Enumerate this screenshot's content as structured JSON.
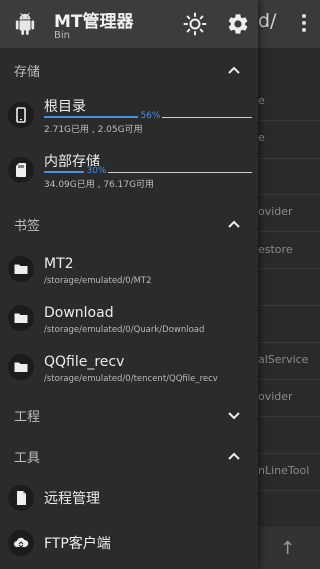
{
  "header": {
    "title": "MT管理器",
    "subtitle": "Bin",
    "icons": {
      "logo": "android-icon",
      "theme": "brightness-icon",
      "settings": "gear-icon"
    }
  },
  "background": {
    "path_fragment": "d/",
    "list_fragments": [
      "e",
      "e",
      "ovider",
      "estore",
      "alService",
      "ovider",
      "nLineTool"
    ]
  },
  "sections": {
    "storage": {
      "label": "存储",
      "expanded": true
    },
    "bookmarks": {
      "label": "书签",
      "expanded": true
    },
    "project": {
      "label": "工程",
      "expanded": false
    },
    "tools": {
      "label": "工具",
      "expanded": true
    }
  },
  "storage_items": [
    {
      "name": "根目录",
      "percent_label": "56%",
      "percent": 56,
      "size": "2.71G已用 , 2.05G可用",
      "icon": "phone-icon"
    },
    {
      "name": "内部存储",
      "percent_label": "30%",
      "percent": 30,
      "size": "34.09G已用 , 76.17G可用",
      "icon": "sd-card-icon"
    }
  ],
  "bookmarks": [
    {
      "name": "MT2",
      "path": "/storage/emulated/0/MT2"
    },
    {
      "name": "Download",
      "path": "/storage/emulated/0/Quark/Download"
    },
    {
      "name": "QQfile_recv",
      "path": "/storage/emulated/0/tencent/QQfile_recv"
    }
  ],
  "tools": [
    {
      "name": "远程管理",
      "icon": "remote-file-icon"
    },
    {
      "name": "FTP客户端",
      "icon": "ftp-cloud-icon"
    }
  ],
  "colors": {
    "accent": "#4b8fe0",
    "drawer_bg": "#2b2b2b",
    "header_bg": "#3c3c3c"
  }
}
